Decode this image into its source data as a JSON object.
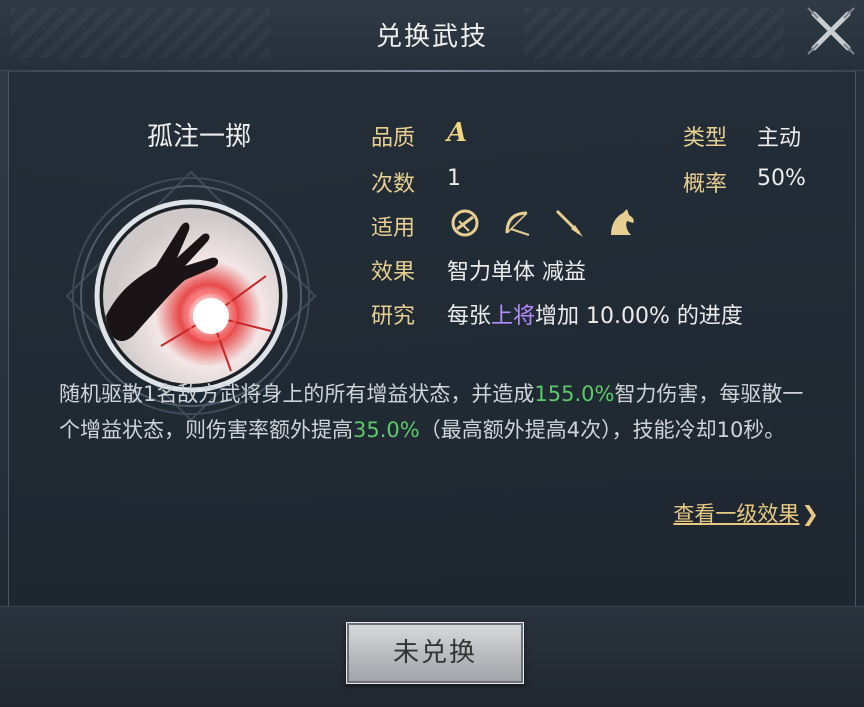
{
  "header": {
    "title": "兑换武技"
  },
  "skill": {
    "name": "孤注一掷",
    "quality_label": "品质",
    "quality_value": "A",
    "count_label": "次数",
    "count_value": "1",
    "apply_label": "适用",
    "apply_icons": [
      "shield-icon",
      "bow-icon",
      "spear-icon",
      "horse-icon"
    ],
    "effect_label": "效果",
    "effect_value": "智力单体 减益",
    "research_label": "研究",
    "research_prefix": "每张",
    "research_highlight": "上将",
    "research_suffix": "增加 10.00% 的进度",
    "type_label": "类型",
    "type_value": "主动",
    "rate_label": "概率",
    "rate_value": "50%"
  },
  "description": {
    "part1": "随机驱散1名敌方武将身上的所有增益状态，并造成",
    "value1": "155.0%",
    "part2": "智力伤害，每驱散一个增益状态，则伤害率额外提高",
    "value2": "35.0%",
    "part3": "（最高额外提高4次），技能冷却10秒。"
  },
  "links": {
    "view_level1": "查看一级效果",
    "chevron": "❯"
  },
  "footer": {
    "button_label": "未兑换"
  },
  "colors": {
    "gold": "#e7cf91",
    "purple": "#b48cff",
    "green": "#5cc96a"
  }
}
